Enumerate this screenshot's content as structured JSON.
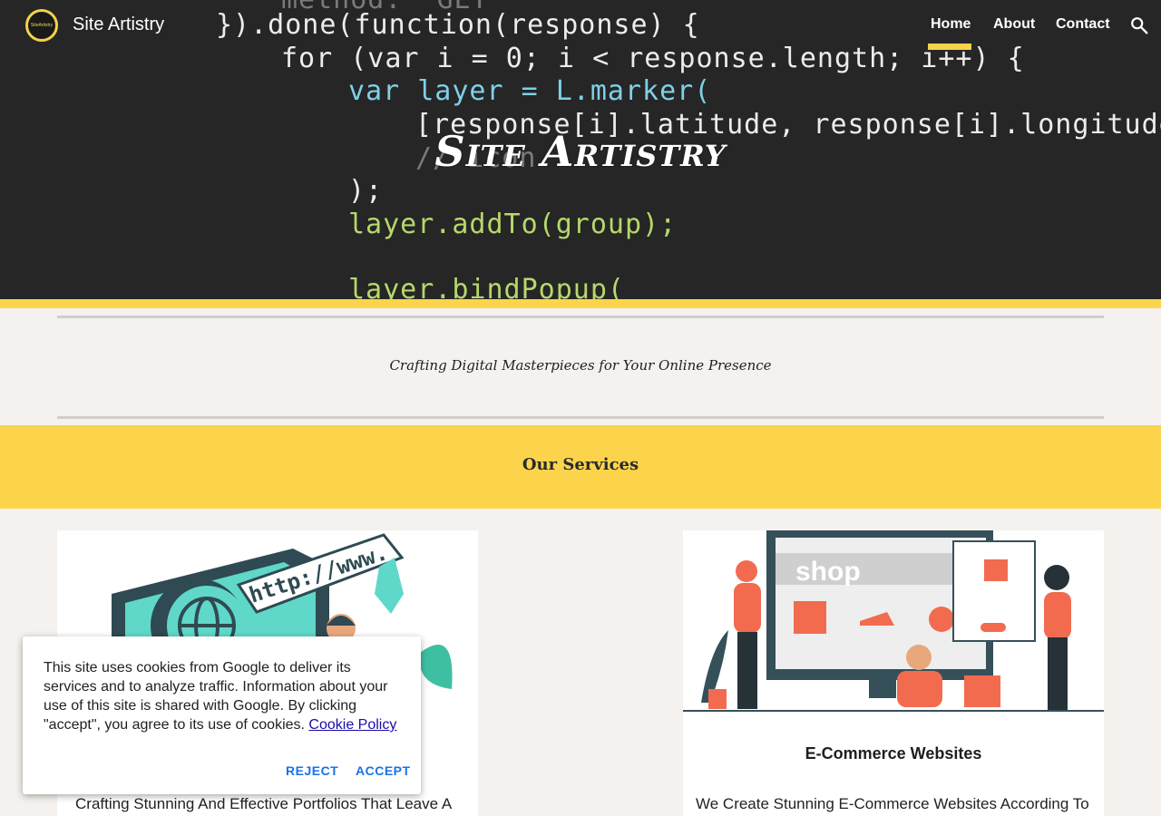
{
  "header": {
    "logo_text": "SiteArtistry",
    "site_name": "Site Artistry",
    "nav": {
      "home": "Home",
      "about": "About",
      "contact": "Contact"
    }
  },
  "hero": {
    "title": "Site Artistry",
    "code_lines": [
      "method: 'GET'",
      "}).done(function(response) {",
      "for (var i = 0; i < response.length; i++) {",
      "var layer = L.marker(",
      "[response[i].latitude, response[i].longitude]",
      "// icon",
      ");",
      "layer.addTo(group);",
      "layer.bindPopup("
    ]
  },
  "tagline": "Crafting Digital Masterpieces for Your Online Presence",
  "services": {
    "title": "Our Services",
    "cards": [
      {
        "title": "",
        "desc": "Crafting Stunning And Effective Portfolios That Leave A"
      },
      {
        "title": "E-Commerce Websites",
        "desc": "We Create Stunning E-Commerce Websites According To"
      }
    ]
  },
  "cookie": {
    "text": "This site uses cookies from Google to deliver its services and to analyze traffic. Information about your use of this site is shared with Google. By clicking \"accept\", you agree to its use of cookies.",
    "link": "Cookie Policy",
    "reject": "REJECT",
    "accept": "ACCEPT"
  },
  "colors": {
    "accent": "#fbd44c",
    "hero_bg": "#262626",
    "link": "#1a73e8"
  },
  "icons": {
    "search": "search-icon",
    "logo": "logo-circle"
  }
}
